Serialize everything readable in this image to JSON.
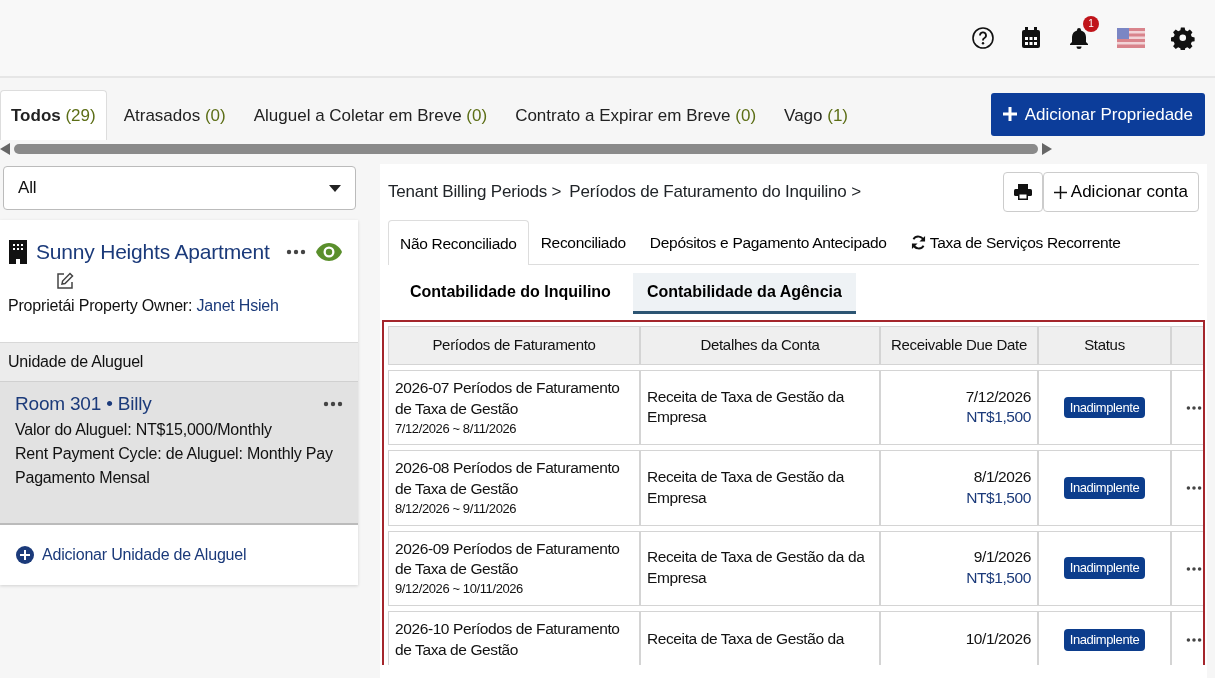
{
  "header": {
    "notification_count": "1"
  },
  "tabs": [
    {
      "label": "Todos",
      "count": "(29)",
      "selected": true
    },
    {
      "label": "Atrasados",
      "count": "(0)",
      "selected": false
    },
    {
      "label": "Aluguel a Coletar em Breve",
      "count": "(0)",
      "selected": false
    },
    {
      "label": "Contrato a Expirar em Breve",
      "count": "(0)",
      "selected": false
    },
    {
      "label": "Vago",
      "count": "(1)",
      "selected": false
    }
  ],
  "add_property_button": "Adicionar Propriedade",
  "filter": {
    "value": "All"
  },
  "property": {
    "name": "Sunny Heights Apartment",
    "owner_label": "Proprietái Property Owner:",
    "owner_name": "Janet Hsieh"
  },
  "units_header": "Unidade de Aluguel",
  "units": [
    {
      "room": "Room 301",
      "separator": "•",
      "tenant": "Billy",
      "selected": true,
      "lines": [
        "Valor do Aluguel: NT$15,000/Monthly",
        "Rent Payment Cycle: de Aluguel: Monthly Pay",
        "Pagamento Mensal"
      ]
    }
  ],
  "add_unit": "Adicionar Unidade de Aluguel",
  "breadcrumb": [
    "Tenant Billing Periods >",
    "Períodos de Faturamento do Inquilino >"
  ],
  "add_account_button": "Adicionar conta",
  "billing_tabs": [
    {
      "label": "Não Reconciliado",
      "selected": true,
      "kind": "plain"
    },
    {
      "label": "Reconciliado",
      "selected": false,
      "kind": "plain"
    },
    {
      "label": "Depósitos e Pagamento Antecipado",
      "selected": false,
      "kind": "plain"
    },
    {
      "label": "Taxa de Serviços Recorrente",
      "selected": false,
      "kind": "recurring"
    }
  ],
  "ledger_tabs": [
    {
      "label": "Contabilidade do Inquilino",
      "selected": false
    },
    {
      "label": "Contabilidade da Agência",
      "selected": true
    }
  ],
  "table": {
    "columns": [
      "Períodos de Faturamento",
      "Detalhes da Conta",
      "Receivable Due Date",
      "Status"
    ],
    "rows": [
      {
        "period": "2026-07 Períodos de Faturamento de Taxa de Gestão",
        "range": "7/12/2026 ~ 8/11/2026",
        "detail": "Receita de Taxa de Gestão da Empresa",
        "due_date": "7/12/2026",
        "amount": "NT$1,500",
        "status": "Inadimplente"
      },
      {
        "period": "2026-08 Períodos de Faturamento de Taxa de Gestão",
        "range": "8/12/2026 ~ 9/11/2026",
        "detail": "Receita de Taxa de Gestão da Empresa",
        "due_date": "8/1/2026",
        "amount": "NT$1,500",
        "status": "Inadimplente"
      },
      {
        "period": "2026-09 Períodos de Faturamento de Taxa de Gestão",
        "range": "9/12/2026 ~ 10/11/2026",
        "detail": "Receita de Taxa de Gestão da da Empresa",
        "due_date": "9/1/2026",
        "amount": "NT$1,500",
        "status": "Inadimplente"
      },
      {
        "period": "2026-10 Períodos de Faturamento de Taxa de Gestão",
        "detail": "Receita de Taxa de Gestão da",
        "due_date": "10/1/2026",
        "status": "Inadimplente"
      }
    ]
  }
}
